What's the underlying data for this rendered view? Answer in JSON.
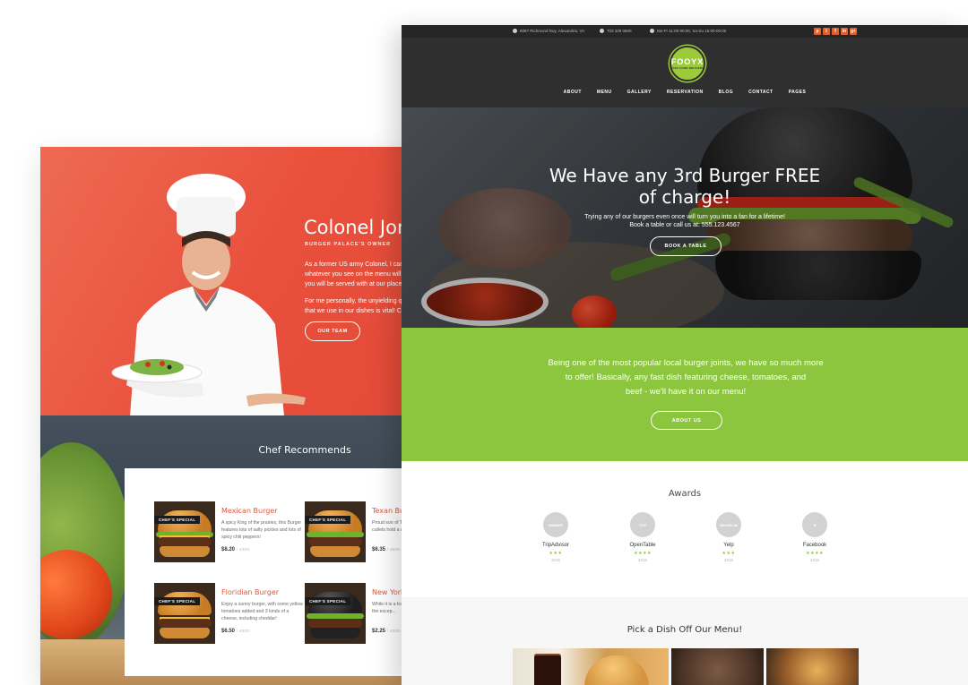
{
  "back_page": {
    "chef": {
      "name": "Colonel Jona",
      "role": "BURGER PALACE'S OWNER",
      "paragraphs": [
        "As a former US army Colonel, I can",
        "whatever you see on the menu will",
        "you will be served with at our place!",
        "For me personally, the unyielding q",
        "that we use in our dishes is vital! Co"
      ],
      "button": "OUR TEAM"
    },
    "recommends": {
      "title": "Chef Recommends",
      "badge": "CHEF'S SPECIAL",
      "dishes": [
        {
          "name": "Mexican Burger",
          "desc": "A spicy King of the prairies, this Burger features lots of salty pickles and lots of spicy chili peppers!",
          "price": "$8.20",
          "weight": "/ 400G"
        },
        {
          "name": "Texan Bur",
          "desc": "Proud son of T... biggest! All the... cutlets hold a d...",
          "price": "$6.35",
          "weight": "/ 450G"
        },
        {
          "name": "Floridian Burger",
          "desc": "Enjoy a sunny burger, with some yellow tomatoes added and 3 kinds of a cheese, including cheddar!",
          "price": "$6.50",
          "weight": "/ 450G"
        },
        {
          "name": "New Yorke",
          "desc": "While it is a tra... burger, it is sim... With the excep...",
          "price": "$2.25",
          "weight": "/ 450G"
        }
      ]
    }
  },
  "front_page": {
    "topbar": {
      "address": "6087 Richmond hwy, Alexandria, VA",
      "phone": "703 329 0600",
      "hours": "Mo-Fr 11:00-00:00, Sa-Su 15:00-00:00",
      "socials": [
        "p",
        "t",
        "f",
        "in",
        "g+"
      ]
    },
    "logo": {
      "title": "FOOYX",
      "subtitle": "FAST FOOD DELIVERY"
    },
    "nav": [
      "ABOUT",
      "MENU",
      "GALLERY",
      "RESERVATION",
      "BLOG",
      "CONTACT",
      "PAGES"
    ],
    "hero": {
      "title_line1": "We Have any 3rd Burger FREE",
      "title_line2": "of charge!",
      "sub_line1": "Trying any of our burgers even once will turn you into a fan for a lifetime!",
      "sub_line2": "Book a table or call us at: 555.123.4567",
      "button": "BOOK A TABLE"
    },
    "intro": {
      "line1": "Being one of the most popular local burger joints, we have so much more",
      "line2": "to offer! Basically, any fast dish featuring cheese, tomatoes, and",
      "line3": "beef - we'll have it on our menu!",
      "button": "ABOUT US"
    },
    "awards": {
      "title": "Awards",
      "items": [
        {
          "name": "TripAdvisor",
          "badge": "WINNER",
          "stars": "★★★",
          "year": "2016"
        },
        {
          "name": "OpenTable",
          "badge": "TOP",
          "stars": "★★★★",
          "year": "2016"
        },
        {
          "name": "Yelp",
          "badge": "MICHELIN",
          "stars": "★★★",
          "year": "2016"
        },
        {
          "name": "Facebook",
          "badge": "★",
          "stars": "★★★★",
          "year": "2016"
        }
      ]
    },
    "menu": {
      "title": "Pick a Dish Off Our Menu!"
    }
  },
  "colors": {
    "accent_green": "#8cc63f",
    "accent_red": "#e9503c",
    "dark": "#2f2f2f"
  }
}
